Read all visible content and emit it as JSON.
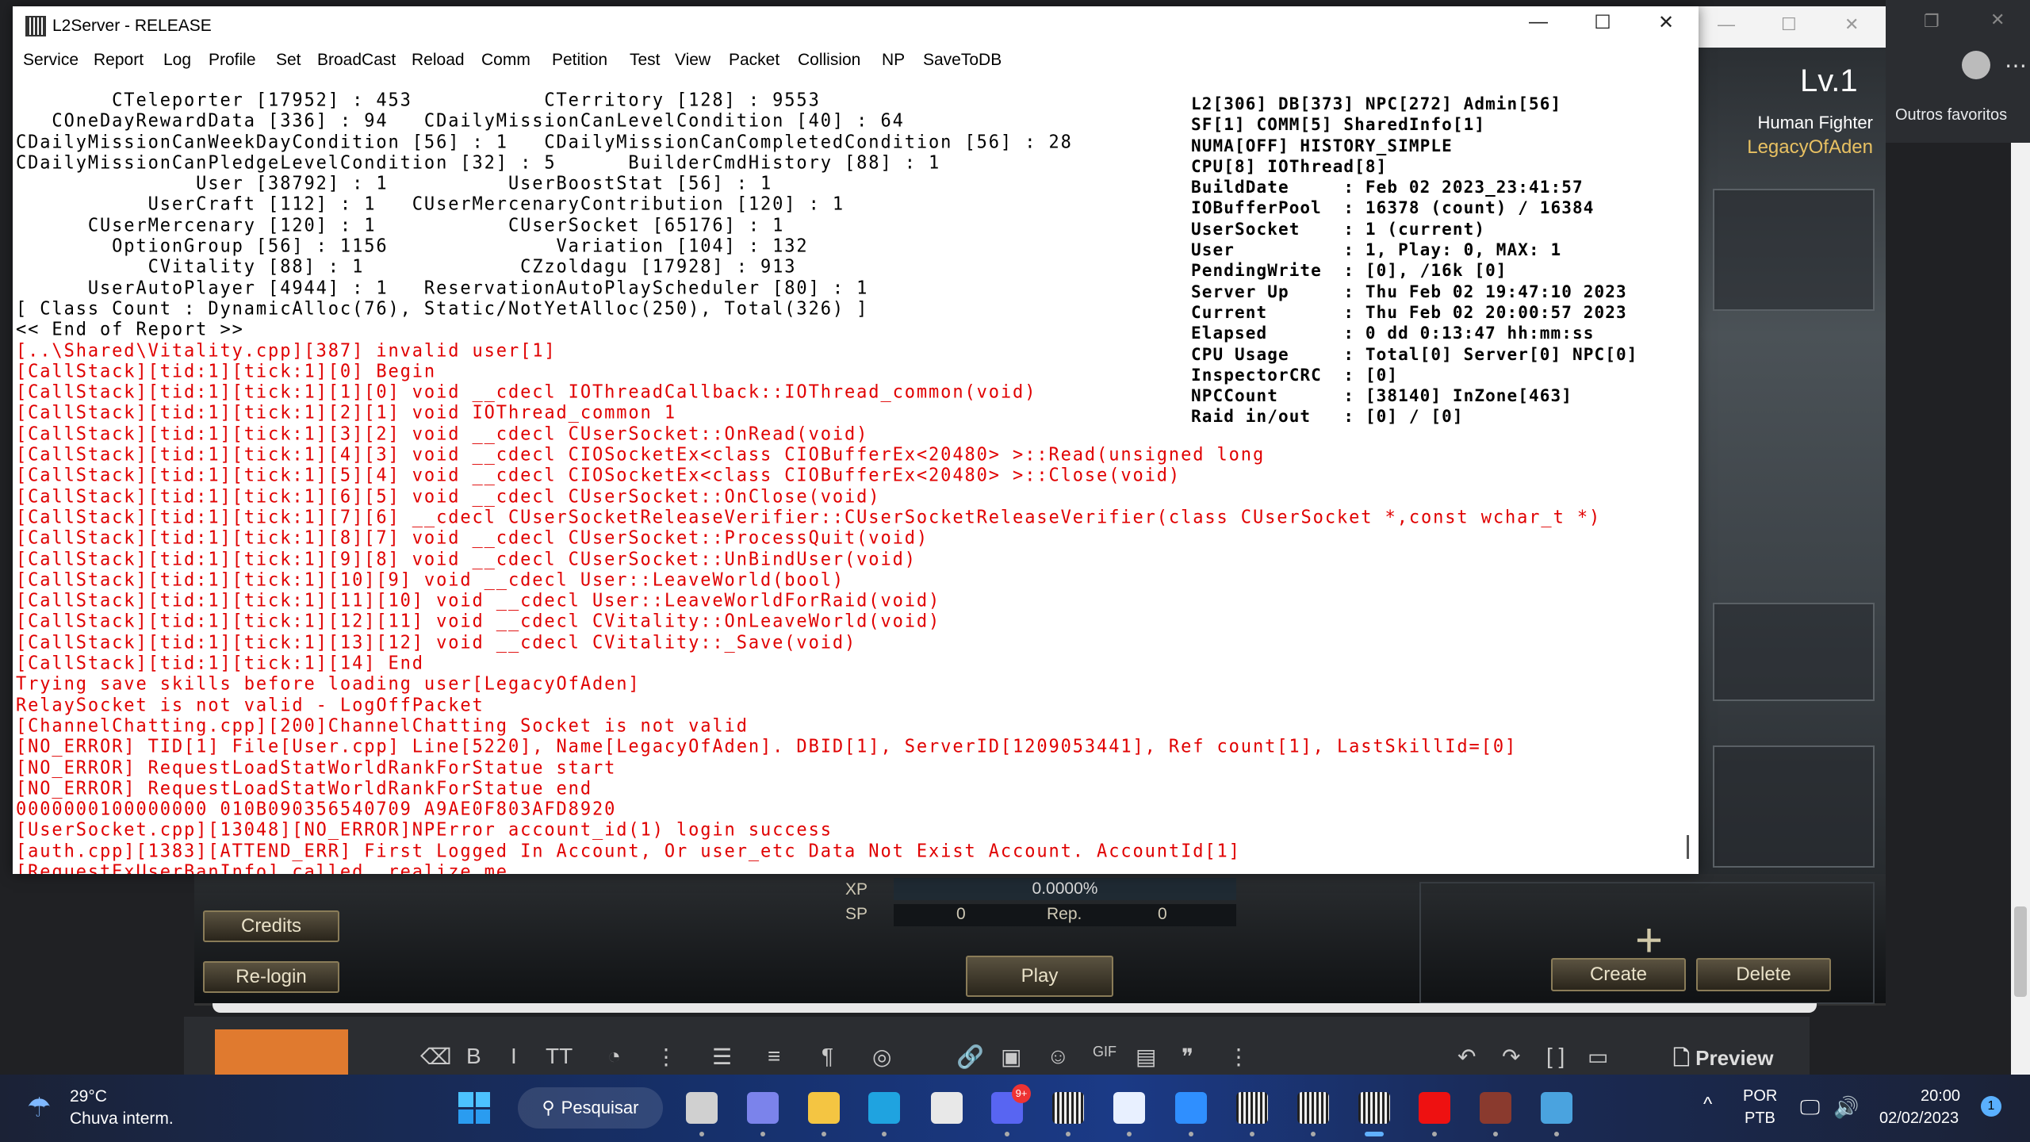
{
  "console": {
    "title": "L2Server - RELEASE",
    "menu": [
      "Service",
      "Report",
      "Log",
      "Profile",
      "Set",
      "BroadCast",
      "Reload",
      "Comm",
      "Petition",
      "Test",
      "View",
      "Packet",
      "Collision",
      "NP",
      "SaveToDB"
    ],
    "report_lines": [
      "        CTeleporter [17952] : 453           CTerritory [128] : 9553",
      "   COneDayRewardData [336] : 94   CDailyMissionCanLevelCondition [40] : 64",
      "CDailyMissionCanWeekDayCondition [56] : 1   CDailyMissionCanCompletedCondition [56] : 28",
      "CDailyMissionCanPledgeLevelCondition [32] : 5      BuilderCmdHistory [88] : 1",
      "               User [38792] : 1          UserBoostStat [56] : 1",
      "           UserCraft [112] : 1   CUserMercenaryContribution [120] : 1",
      "      CUserMercenary [120] : 1           CUserSocket [65176] : 1",
      "        OptionGroup [56] : 1156              Variation [104] : 132",
      "           CVitality [88] : 1             CZzoldagu [17928] : 913",
      "      UserAutoPlayer [4944] : 1   ReservationAutoPlayScheduler [80] : 1",
      "[ Class Count : DynamicAlloc(76), Static/NotYetAlloc(250), Total(326) ]",
      "<< End of Report >>"
    ],
    "log_lines": [
      "[..\\Shared\\Vitality.cpp][387] invalid user[1]",
      "[CallStack][tid:1][tick:1][0] Begin",
      "[CallStack][tid:1][tick:1][1][0] void __cdecl IOThreadCallback::IOThread_common(void)",
      "[CallStack][tid:1][tick:1][2][1] void IOThread_common 1",
      "[CallStack][tid:1][tick:1][3][2] void __cdecl CUserSocket::OnRead(void)",
      "[CallStack][tid:1][tick:1][4][3] void __cdecl CIOSocketEx<class CIOBufferEx<20480> >::Read(unsigned long",
      "[CallStack][tid:1][tick:1][5][4] void __cdecl CIOSocketEx<class CIOBufferEx<20480> >::Close(void)",
      "[CallStack][tid:1][tick:1][6][5] void __cdecl CUserSocket::OnClose(void)",
      "[CallStack][tid:1][tick:1][7][6] __cdecl CUserSocketReleaseVerifier::CUserSocketReleaseVerifier(class CUserSocket *,const wchar_t *)",
      "[CallStack][tid:1][tick:1][8][7] void __cdecl CUserSocket::ProcessQuit(void)",
      "[CallStack][tid:1][tick:1][9][8] void __cdecl CUserSocket::UnBindUser(void)",
      "[CallStack][tid:1][tick:1][10][9] void __cdecl User::LeaveWorld(bool)",
      "[CallStack][tid:1][tick:1][11][10] void __cdecl User::LeaveWorldForRaid(void)",
      "[CallStack][tid:1][tick:1][12][11] void __cdecl CVitality::OnLeaveWorld(void)",
      "[CallStack][tid:1][tick:1][13][12] void __cdecl CVitality::_Save(void)",
      "[CallStack][tid:1][tick:1][14] End",
      "Trying save skills before loading user[LegacyOfAden]",
      "RelaySocket is not valid - LogOffPacket",
      "[ChannelChatting.cpp][200]ChannelChatting Socket is not valid",
      "[NO_ERROR] TID[1] File[User.cpp] Line[5220], Name[LegacyOfAden]. DBID[1], ServerID[1209053441], Ref count[1], LastSkillId=[0]",
      "[NO_ERROR] RequestLoadStatWorldRankForStatue start",
      "[NO_ERROR] RequestLoadStatWorldRankForStatue end",
      "0000000100000000 010B090356540709 A9AE0F803AFD8920",
      "[UserSocket.cpp][13048][NO_ERROR]NPError account_id(1) login success",
      "[auth.cpp][1383][ATTEND_ERR] First Logged In Account, Or user_etc Data Not Exist Account. AccountId[1]",
      "[RequestExUserBanInfo] called, realize me"
    ],
    "status_lines": [
      "L2[306] DB[373] NPC[272] Admin[56]",
      "SF[1] COMM[5] SharedInfo[1]",
      "NUMA[OFF] HISTORY_SIMPLE",
      "CPU[8] IOThread[8]",
      "BuildDate     : Feb 02 2023_23:41:57",
      "IOBufferPool  : 16378 (count) / 16384",
      "UserSocket    : 1 (current)",
      "User          : 1, Play: 0, MAX: 1",
      "PendingWrite  : [0], /16k [0]",
      "Server Up     : Thu Feb 02 19:47:10 2023",
      "Current       : Thu Feb 02 20:00:57 2023",
      "Elapsed       : 0 dd 0:13:47 hh:mm:ss",
      "CPU Usage     : Total[0] Server[0] NPC[0]",
      "InspectorCRC  : [0]",
      "NPCCount      : [38140] InZone[463]",
      "Raid in/out   : [0] / [0]"
    ],
    "colors": {
      "log_error": "#e00000",
      "report": "#000000"
    }
  },
  "game": {
    "level": "Lv.1",
    "race_class": "Human Fighter",
    "character_name": "LegacyOfAden",
    "xp_label": "XP",
    "xp_value": "0.0000%",
    "xp_fill": 0,
    "sp_label": "SP",
    "sp_value": "0",
    "rep_label": "Rep.",
    "rep_value": "0",
    "buttons": {
      "credits": "Credits",
      "relogin": "Re-login",
      "play": "Play",
      "create": "Create",
      "delete": "Delete"
    }
  },
  "browser": {
    "bookmarks_other": "Outros favoritos",
    "editor_preview": "Preview",
    "editor_toolbar_icons": [
      "eraser-icon",
      "bold-icon",
      "italic-icon",
      "text-size-icon",
      "palette-icon",
      "more-icon",
      "list-icon",
      "align-icon",
      "paragraph-icon",
      "hide-icon",
      "link-icon",
      "image-icon",
      "emoji-icon",
      "gif-icon",
      "media-icon",
      "quote-icon",
      "more-icon",
      "undo-icon",
      "redo-icon",
      "brackets-icon",
      "save-icon"
    ]
  },
  "taskbar": {
    "weather_temp": "29°C",
    "weather_desc": "Chuva interm.",
    "search_label": "Pesquisar",
    "lang_top": "POR",
    "lang_bottom": "PTB",
    "time": "20:00",
    "date": "02/02/2023",
    "notification_count": "1",
    "discord_badge": "9+"
  }
}
